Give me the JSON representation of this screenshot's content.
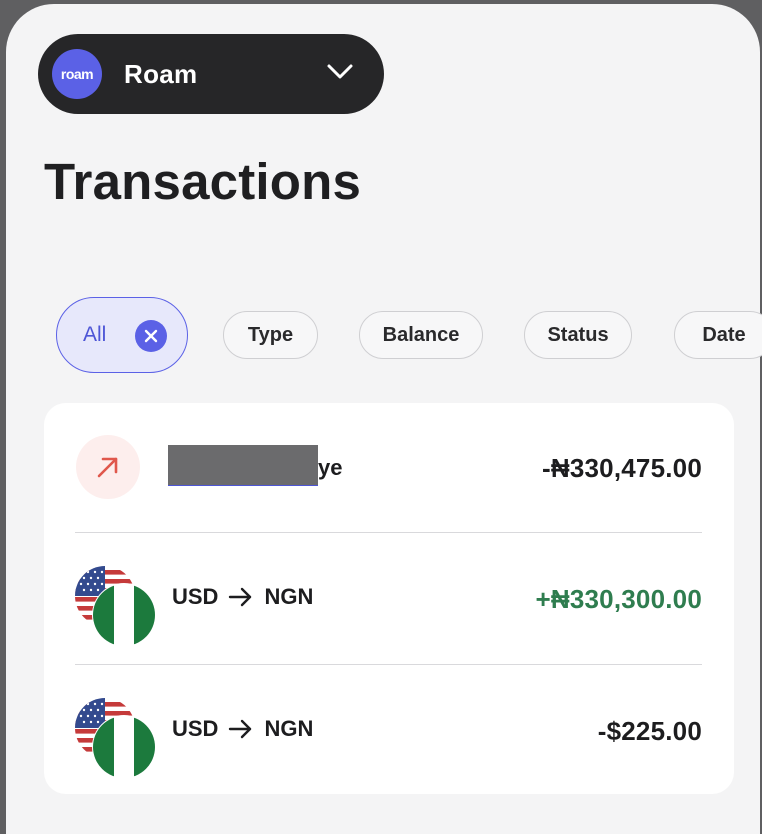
{
  "app": {
    "name": "Roam",
    "logo_text": "roam"
  },
  "page": {
    "title": "Transactions"
  },
  "filters": {
    "all": "All",
    "chips": [
      "Type",
      "Balance",
      "Status",
      "Date"
    ]
  },
  "transactions": [
    {
      "name_visible": "ye",
      "amount": "-₦330,475.00",
      "direction": "outgoing"
    },
    {
      "from": "USD",
      "to": "NGN",
      "amount": "+₦330,300.00",
      "direction": "conversion-in"
    },
    {
      "from": "USD",
      "to": "NGN",
      "amount": "-$225.00",
      "direction": "conversion-out"
    }
  ],
  "colors": {
    "accent": "#5b61e6",
    "positive": "#2f7d4f",
    "negative_icon": "#e0574c"
  }
}
